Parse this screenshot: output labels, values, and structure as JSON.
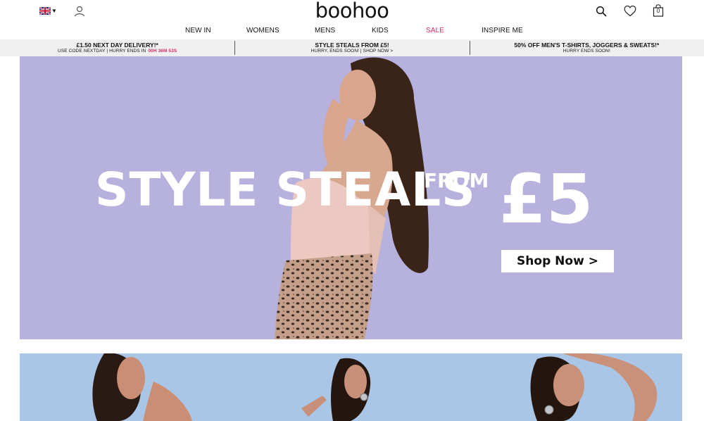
{
  "header": {
    "logo": "boohoo",
    "bag_count": "0"
  },
  "nav": {
    "items": [
      "NEW IN",
      "WOMENS",
      "MENS",
      "KIDS",
      "SALE",
      "INSPIRE ME"
    ]
  },
  "promos": [
    {
      "title": "£1.50 NEXT DAY DELIVERY!*",
      "sub": "USE CODE NEXTDAY | HURRY ENDS IN",
      "timer": "00H 36M 53S"
    },
    {
      "title": "STYLE STEALS FROM £5!",
      "sub": "HURRY, ENDS SOON! | SHOP NOW >"
    },
    {
      "title": "50% OFF MEN'S T-SHIRTS, JOGGERS & SWEATS!*",
      "sub": "HURRY ENDS SOON!"
    }
  ],
  "hero": {
    "headline": "STYLE STEALS",
    "from": "FROM",
    "price": "£5",
    "cta": "Shop Now >"
  },
  "colors": {
    "sale": "#d22d63",
    "hero_bg": "#b7b1dd",
    "banner2_bg": "#a9c6e6"
  }
}
